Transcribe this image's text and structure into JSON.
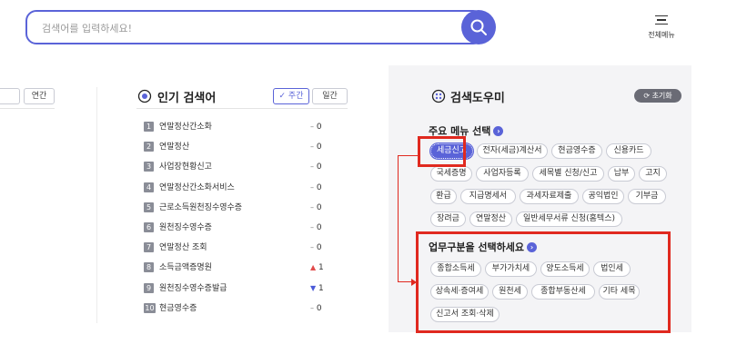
{
  "search": {
    "placeholder": "검색어를 입력하세요!"
  },
  "header": {
    "menu_label": "전체메뉴"
  },
  "left": {
    "tab_label": "연간"
  },
  "popular": {
    "title": "인기 검색어",
    "tab_weekly": "✓ 주간",
    "tab_daily": "일간",
    "items": [
      {
        "rank": "1",
        "keyword": "연말정산간소화",
        "change": "0",
        "dir": "same",
        "mark": "–"
      },
      {
        "rank": "2",
        "keyword": "연말정산",
        "change": "0",
        "dir": "same",
        "mark": "–"
      },
      {
        "rank": "3",
        "keyword": "사업장현황신고",
        "change": "0",
        "dir": "same",
        "mark": "–"
      },
      {
        "rank": "4",
        "keyword": "연말정산간소화서비스",
        "change": "0",
        "dir": "same",
        "mark": "–"
      },
      {
        "rank": "5",
        "keyword": "근로소득원천징수영수증",
        "change": "0",
        "dir": "same",
        "mark": "–"
      },
      {
        "rank": "6",
        "keyword": "원천징수영수증",
        "change": "0",
        "dir": "same",
        "mark": "–"
      },
      {
        "rank": "7",
        "keyword": "연말정산 조회",
        "change": "0",
        "dir": "same",
        "mark": "–"
      },
      {
        "rank": "8",
        "keyword": "소득금액증명원",
        "change": "1",
        "dir": "up",
        "mark": "▲"
      },
      {
        "rank": "9",
        "keyword": "원천징수영수증발급",
        "change": "1",
        "dir": "down",
        "mark": "▼"
      },
      {
        "rank": "10",
        "keyword": "현금영수증",
        "change": "0",
        "dir": "same",
        "mark": "–"
      }
    ]
  },
  "helper": {
    "title": "검색도우미",
    "reset_label": "⟳ 초기화",
    "main_menu_title": "주요 메뉴 선택",
    "main_menu": [
      "세금신고",
      "전자(세금)계산서",
      "현금영수증",
      "신용카드",
      "국세증명",
      "사업자등록",
      "세목별 신청/신고",
      "납부",
      "고지",
      "환급",
      "지급명세서",
      "과세자료제출",
      "공익법인",
      "기부금",
      "장려금",
      "연말정산",
      "일반세무서류 신청(홈텍스)"
    ],
    "work_title": "업무구분을 선택하세요",
    "work_items": [
      "종합소득세",
      "부가가치세",
      "양도소득세",
      "법인세",
      "상속세·증여세",
      "원천세",
      "종합부동산세",
      "기타 세목",
      "신고서 조회·삭제"
    ]
  },
  "colors": {
    "accent": "#5a63d8",
    "highlight": "#e0291f",
    "panel_bg": "#f4f4f6"
  }
}
